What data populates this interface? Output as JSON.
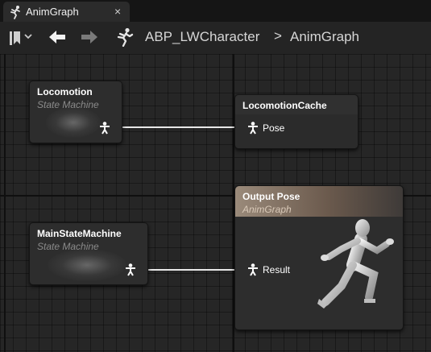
{
  "tab": {
    "label": "AnimGraph",
    "close": "×",
    "icon": "anim-graph-icon"
  },
  "toolbar": {
    "bookmark_icon": "bookmark-icon",
    "back_icon": "back-arrow-icon",
    "forward_icon": "forward-arrow-icon"
  },
  "breadcrumb": {
    "root": "ABP_LWCharacter",
    "separator": ">",
    "leaf": "AnimGraph"
  },
  "nodes": {
    "locomotion": {
      "title": "Locomotion",
      "subtitle": "State Machine"
    },
    "cache": {
      "title": "LocomotionCache",
      "pin": "Pose"
    },
    "main": {
      "title": "MainStateMachine",
      "subtitle": "State Machine"
    },
    "output": {
      "title": "Output Pose",
      "subtitle": "AnimGraph",
      "pin": "Result"
    }
  },
  "colors": {
    "wire": "#e8e8e8",
    "output_header": "#9a8a7a",
    "grid": "#262626"
  }
}
